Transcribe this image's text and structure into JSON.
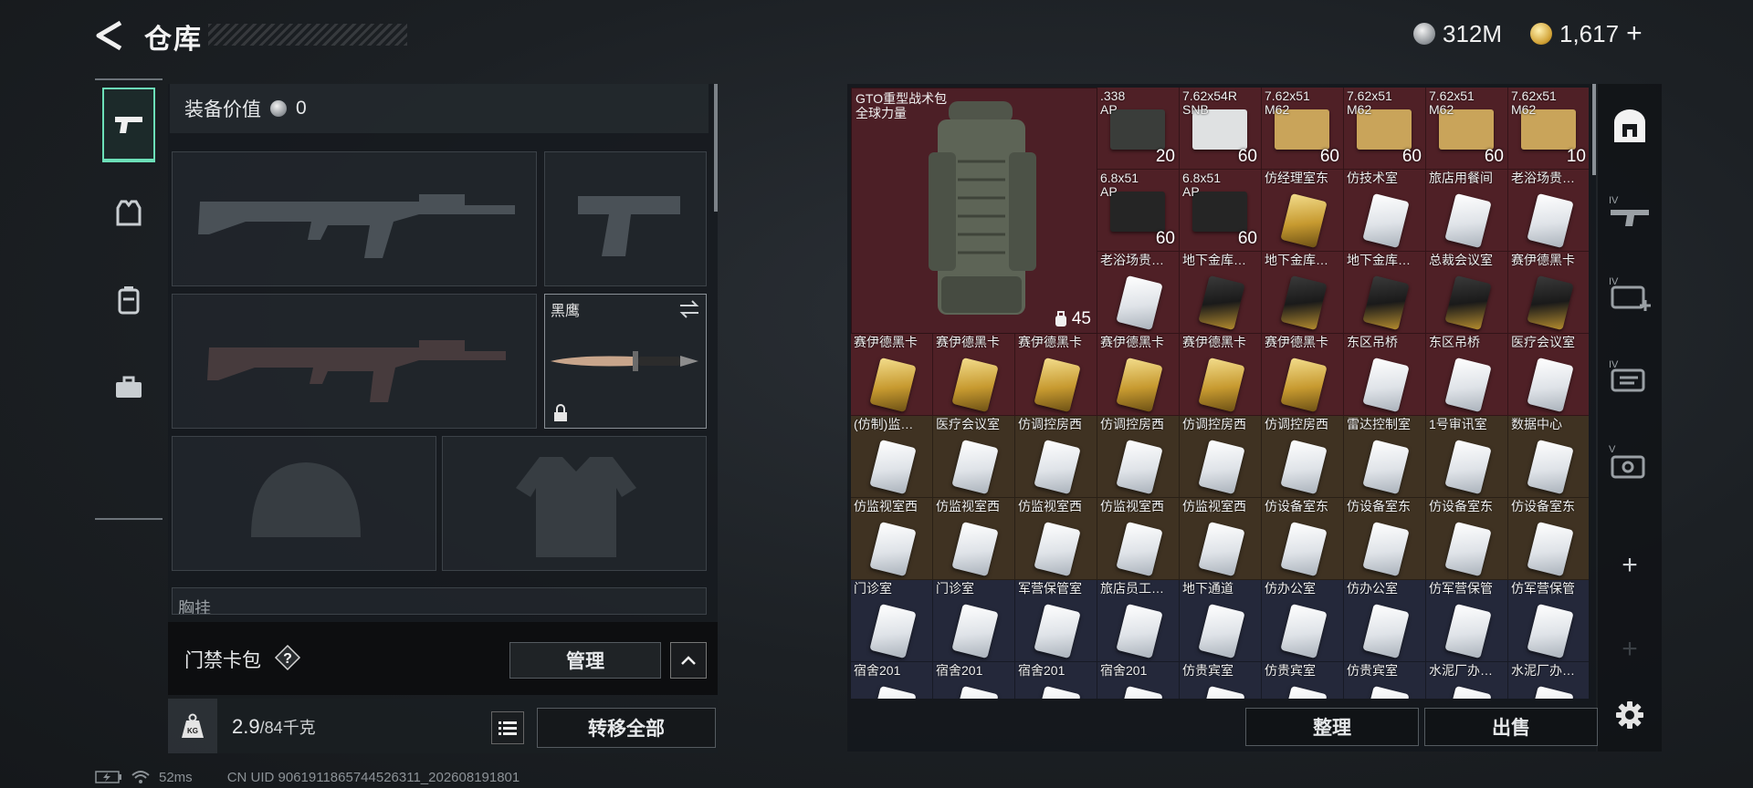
{
  "header": {
    "title": "仓库"
  },
  "currency": [
    {
      "icon": "silver-coin-icon",
      "value": "312M"
    },
    {
      "icon": "gold-coin-icon",
      "value": "1,617"
    }
  ],
  "loadout": {
    "gear_value_label": "装备价值",
    "gear_value": "0",
    "melee_name": "黑鹰",
    "chest_label_partial": "胸挂"
  },
  "card_bag": {
    "label": "门禁卡包",
    "manage": "管理"
  },
  "weight": {
    "current": "2.9",
    "max": "/84千克",
    "transfer_all": "转移全部"
  },
  "status": {
    "ping": "52ms",
    "uid": "CN UID 9061911865744526311_202608191801"
  },
  "storage": {
    "backpack": {
      "name": "GTO重型战术包",
      "sub": "全球力量",
      "capacity": "45"
    },
    "rows": [
      [
        {
          "name": ".338\nAP",
          "qty": "20",
          "kind": "ammo-dark"
        },
        {
          "name": "7.62x54R\nSNB",
          "qty": "60",
          "kind": "ammo-white"
        },
        {
          "name": "7.62x51\nM62",
          "qty": "60",
          "kind": "ammo-tan"
        },
        {
          "name": "7.62x51\nM62",
          "qty": "60",
          "kind": "ammo-tan"
        },
        {
          "name": "7.62x51\nM62",
          "qty": "60",
          "kind": "ammo-tan"
        },
        {
          "name": "7.62x51\nM62",
          "qty": "10",
          "kind": "ammo-tan"
        }
      ],
      [
        {
          "name": "6.8x51\nAP",
          "qty": "60",
          "kind": "ammo-black"
        },
        {
          "name": "6.8x51\nAP",
          "qty": "60",
          "kind": "ammo-black"
        },
        {
          "name": "仿经理室东",
          "qty": "",
          "kind": "card-gold"
        },
        {
          "name": "仿技术室",
          "qty": "",
          "kind": "card-white"
        },
        {
          "name": "旅店用餐间",
          "qty": "",
          "kind": "card-white"
        },
        {
          "name": "老浴场贵…",
          "qty": "",
          "kind": "card-white"
        }
      ],
      [
        {
          "name": "老浴场贵…",
          "qty": "",
          "kind": "card-white"
        },
        {
          "name": "地下金库…",
          "qty": "",
          "kind": "card-black"
        },
        {
          "name": "地下金库…",
          "qty": "",
          "kind": "card-black"
        },
        {
          "name": "地下金库…",
          "qty": "",
          "kind": "card-black"
        },
        {
          "name": "总裁会议室",
          "qty": "",
          "kind": "card-black"
        },
        {
          "name": "赛伊德黑卡",
          "qty": "",
          "kind": "card-black"
        }
      ],
      [
        {
          "name": "赛伊德黑卡",
          "qty": "",
          "kind": "card-gold"
        },
        {
          "name": "赛伊德黑卡",
          "qty": "",
          "kind": "card-gold"
        },
        {
          "name": "赛伊德黑卡",
          "qty": "",
          "kind": "card-gold"
        },
        {
          "name": "赛伊德黑卡",
          "qty": "",
          "kind": "card-gold"
        },
        {
          "name": "赛伊德黑卡",
          "qty": "",
          "kind": "card-gold"
        },
        {
          "name": "赛伊德黑卡",
          "qty": "",
          "kind": "card-gold"
        },
        {
          "name": "东区吊桥",
          "qty": "",
          "kind": "card-white"
        },
        {
          "name": "东区吊桥",
          "qty": "",
          "kind": "card-white"
        },
        {
          "name": "医疗会议室",
          "qty": "",
          "kind": "card-white"
        }
      ],
      [
        {
          "name": "(仿制)监…",
          "qty": "",
          "kind": "card-white"
        },
        {
          "name": "医疗会议室",
          "qty": "",
          "kind": "card-white"
        },
        {
          "name": "仿调控房西",
          "qty": "",
          "kind": "card-white"
        },
        {
          "name": "仿调控房西",
          "qty": "",
          "kind": "card-white"
        },
        {
          "name": "仿调控房西",
          "qty": "",
          "kind": "card-white"
        },
        {
          "name": "仿调控房西",
          "qty": "",
          "kind": "card-white"
        },
        {
          "name": "雷达控制室",
          "qty": "",
          "kind": "card-white"
        },
        {
          "name": "1号审讯室",
          "qty": "",
          "kind": "card-white"
        },
        {
          "name": "数据中心",
          "qty": "",
          "kind": "card-white"
        }
      ],
      [
        {
          "name": "仿监视室西",
          "qty": "",
          "kind": "card-white"
        },
        {
          "name": "仿监视室西",
          "qty": "",
          "kind": "card-white"
        },
        {
          "name": "仿监视室西",
          "qty": "",
          "kind": "card-white"
        },
        {
          "name": "仿监视室西",
          "qty": "",
          "kind": "card-white"
        },
        {
          "name": "仿监视室西",
          "qty": "",
          "kind": "card-white"
        },
        {
          "name": "仿设备室东",
          "qty": "",
          "kind": "card-white"
        },
        {
          "name": "仿设备室东",
          "qty": "",
          "kind": "card-white"
        },
        {
          "name": "仿设备室东",
          "qty": "",
          "kind": "card-white"
        },
        {
          "name": "仿设备室东",
          "qty": "",
          "kind": "card-white"
        }
      ],
      [
        {
          "name": "门诊室",
          "qty": "",
          "kind": "card-white"
        },
        {
          "name": "门诊室",
          "qty": "",
          "kind": "card-white"
        },
        {
          "name": "军营保管室",
          "qty": "",
          "kind": "card-white"
        },
        {
          "name": "旅店员工…",
          "qty": "",
          "kind": "card-white"
        },
        {
          "name": "地下通道",
          "qty": "",
          "kind": "card-white"
        },
        {
          "name": "仿办公室",
          "qty": "",
          "kind": "card-white"
        },
        {
          "name": "仿办公室",
          "qty": "",
          "kind": "card-white"
        },
        {
          "name": "仿军营保管",
          "qty": "",
          "kind": "card-white"
        },
        {
          "name": "仿军营保管",
          "qty": "",
          "kind": "card-white"
        }
      ],
      [
        {
          "name": "宿舍201",
          "qty": "",
          "kind": "card-white"
        },
        {
          "name": "宿舍201",
          "qty": "",
          "kind": "card-white"
        },
        {
          "name": "宿舍201",
          "qty": "",
          "kind": "card-white"
        },
        {
          "name": "宿舍201",
          "qty": "",
          "kind": "card-white"
        },
        {
          "name": "仿贵宾室",
          "qty": "",
          "kind": "card-white"
        },
        {
          "name": "仿贵宾室",
          "qty": "",
          "kind": "card-white"
        },
        {
          "name": "仿贵宾室",
          "qty": "",
          "kind": "card-white"
        },
        {
          "name": "水泥厂办…",
          "qty": "",
          "kind": "card-white"
        },
        {
          "name": "水泥厂办…",
          "qty": "",
          "kind": "card-white"
        }
      ]
    ],
    "sort_label": "整理",
    "sell_label": "出售"
  },
  "colors": {
    "row_red": "#4f2026",
    "row_brown": "#3f3222",
    "row_blue": "#24283a",
    "accent": "#6ce0b8"
  },
  "right_rail": [
    {
      "icon": "safebox-icon"
    },
    {
      "icon": "level4-weapon-case-icon",
      "label": "IV"
    },
    {
      "icon": "level4-medical-case-icon",
      "label": "IV"
    },
    {
      "icon": "level4-ammo-case-icon",
      "label": "IV"
    },
    {
      "icon": "level5-tool-case-icon",
      "label": "V"
    },
    {
      "icon": "add-icon"
    },
    {
      "icon": "add-icon-disabled"
    },
    {
      "icon": "gear-icon"
    }
  ]
}
